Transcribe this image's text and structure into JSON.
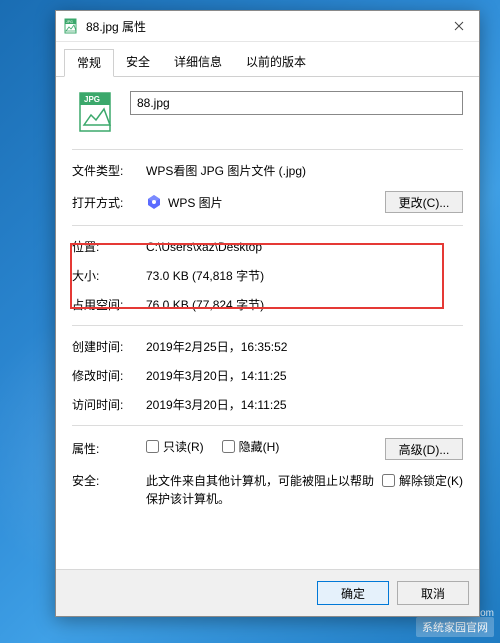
{
  "window": {
    "title": "88.jpg 属性",
    "close": "✕"
  },
  "tabs": {
    "general": "常规",
    "security": "安全",
    "details": "详细信息",
    "previous": "以前的版本"
  },
  "file": {
    "name": "88.jpg",
    "type_label": "文件类型:",
    "type_value": "WPS看图 JPG 图片文件 (.jpg)",
    "open_label": "打开方式:",
    "open_app": "WPS 图片",
    "change_btn": "更改(C)...",
    "loc_label": "位置:",
    "loc_value": "C:\\Users\\xaz\\Desktop",
    "size_label": "大小:",
    "size_value": "73.0 KB (74,818 字节)",
    "disk_label": "占用空间:",
    "disk_value": "76.0 KB (77,824 字节)",
    "created_label": "创建时间:",
    "created_value": "2019年2月25日，16:35:52",
    "modified_label": "修改时间:",
    "modified_value": "2019年3月20日，14:11:25",
    "accessed_label": "访问时间:",
    "accessed_value": "2019年3月20日，14:11:25",
    "attr_label": "属性:",
    "readonly": "只读(R)",
    "hidden": "隐藏(H)",
    "advanced_btn": "高级(D)...",
    "sec_label": "安全:",
    "sec_text": "此文件来自其他计算机，可能被阻止以帮助保护该计算机。",
    "unblock": "解除锁定(K)"
  },
  "footer": {
    "ok": "确定",
    "cancel": "取消"
  },
  "watermark": {
    "main": "系统家园官网",
    "sub": "hnzkhbsb.com"
  },
  "icons": {
    "jpg_badge": "JPG"
  }
}
